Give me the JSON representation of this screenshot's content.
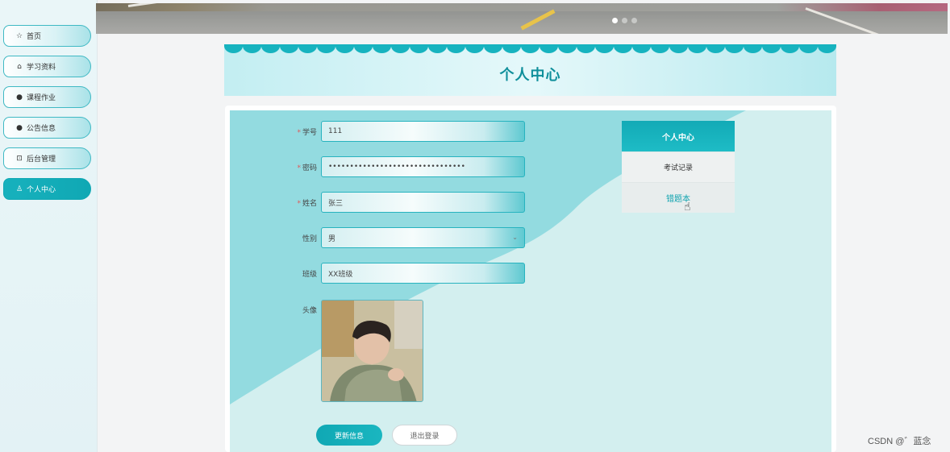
{
  "sidebar": {
    "items": [
      {
        "icon": "star-icon",
        "glyph": "☆",
        "label": "首页"
      },
      {
        "icon": "lock-icon",
        "glyph": "⌂",
        "label": "学习资料"
      },
      {
        "icon": "info-icon",
        "glyph": "●",
        "label": "课程作业"
      },
      {
        "icon": "question-icon",
        "glyph": "●",
        "label": "公告信息"
      },
      {
        "icon": "gift-icon",
        "glyph": "⊡",
        "label": "后台管理"
      },
      {
        "icon": "user-icon",
        "glyph": "♙",
        "label": "个人中心"
      }
    ],
    "active_index": 5
  },
  "banner": {
    "slides": 3,
    "active_slide": 1
  },
  "page": {
    "title": "个人中心"
  },
  "form": {
    "fields": [
      {
        "label": "学号",
        "required": true,
        "value": "111"
      },
      {
        "label": "密码",
        "required": true,
        "value": "••••••••••••••••••••••••••••••••"
      },
      {
        "label": "姓名",
        "required": true,
        "value": "张三"
      },
      {
        "label": "性别",
        "required": false,
        "value": "男",
        "type": "select"
      },
      {
        "label": "班级",
        "required": false,
        "value": "XX班级"
      }
    ],
    "avatar_label": "头像",
    "required_mark": "*",
    "update_button": "更新信息",
    "logout_button": "退出登录"
  },
  "side_menu": {
    "header": "个人中心",
    "items": [
      "考试记录",
      "错题本"
    ]
  },
  "cursor": "pointer-hand-icon",
  "watermark": "CSDN @゛蓝念",
  "colors": {
    "accent": "#10a8b4",
    "panel_bg": "#d3efef",
    "wave": "#93dbe0"
  }
}
